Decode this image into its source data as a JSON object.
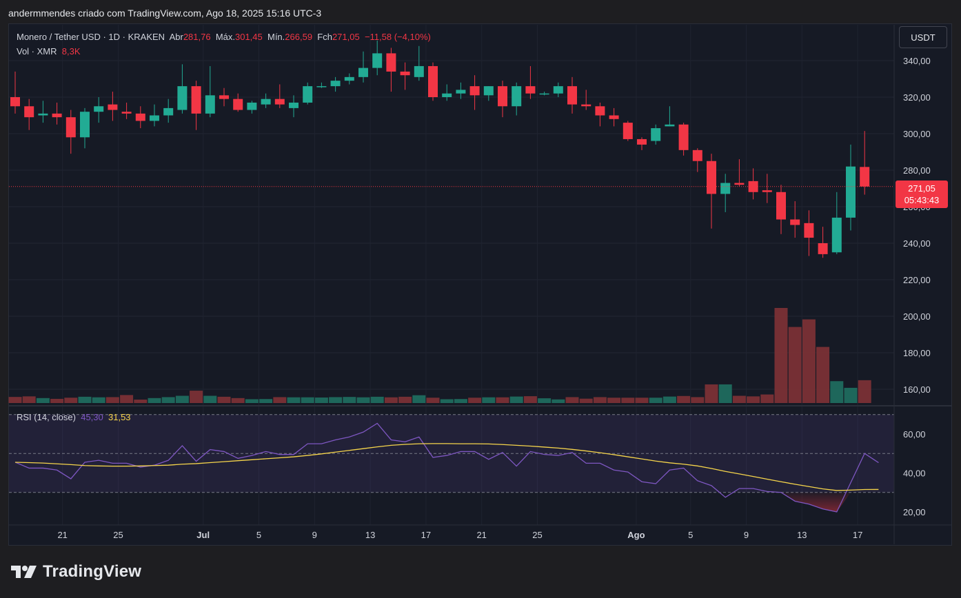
{
  "header": {
    "attribution": "andermmendes criado com TradingView.com, Ago 18, 2025 15:16 UTC-3"
  },
  "legend": {
    "symbol": "Monero / Tether USD · 1D · KRAKEN",
    "open_label": "Abr",
    "open": "281,76",
    "high_label": "Máx.",
    "high": "301,45",
    "low_label": "Mín.",
    "low": "266,59",
    "close_label": "Fch",
    "close": "271,05",
    "change": "−11,58 (−4,10%)",
    "volume_label": "Vol · XMR",
    "volume": "8,3K"
  },
  "currency_button": "USDT",
  "price_tag": {
    "price": "271,05",
    "countdown": "05:43:43"
  },
  "rsi_legend": {
    "label": "RSI (14, close)",
    "rsi": "45,30",
    "ma": "31,53"
  },
  "logo": {
    "text": "TradingView"
  },
  "colors": {
    "up": "#22ab94",
    "down": "#f23645",
    "rsi": "#7e57c2",
    "rsi_ma": "#f7d64b",
    "background": "#161a25"
  },
  "chart_data": [
    {
      "type": "candlestick",
      "title": "Monero / Tether USD · 1D · KRAKEN",
      "ylim": [
        150,
        350
      ],
      "y_ticks": [
        "160,00",
        "180,00",
        "200,00",
        "220,00",
        "240,00",
        "260,00",
        "280,00",
        "300,00",
        "320,00",
        "340,00"
      ],
      "x_ticks": [
        "21",
        "25",
        "Jul",
        "5",
        "9",
        "13",
        "17",
        "21",
        "25",
        "Ago",
        "5",
        "9",
        "13",
        "17"
      ],
      "current_price": 271.05,
      "candles": [
        {
          "o": 320,
          "h": 334,
          "l": 311,
          "c": 315
        },
        {
          "o": 315,
          "h": 319,
          "l": 302,
          "c": 309
        },
        {
          "o": 310,
          "h": 318,
          "l": 306,
          "c": 311
        },
        {
          "o": 311,
          "h": 317,
          "l": 305,
          "c": 309
        },
        {
          "o": 309,
          "h": 313,
          "l": 289,
          "c": 298
        },
        {
          "o": 298,
          "h": 314,
          "l": 292,
          "c": 312
        },
        {
          "o": 312,
          "h": 320,
          "l": 306,
          "c": 315
        },
        {
          "o": 316,
          "h": 323,
          "l": 307,
          "c": 313
        },
        {
          "o": 312,
          "h": 317,
          "l": 308,
          "c": 311
        },
        {
          "o": 311,
          "h": 315,
          "l": 303,
          "c": 307
        },
        {
          "o": 307,
          "h": 316,
          "l": 304,
          "c": 310
        },
        {
          "o": 310,
          "h": 319,
          "l": 306,
          "c": 314
        },
        {
          "o": 313,
          "h": 338,
          "l": 311,
          "c": 326
        },
        {
          "o": 326,
          "h": 329,
          "l": 302,
          "c": 311
        },
        {
          "o": 311,
          "h": 337,
          "l": 309,
          "c": 321
        },
        {
          "o": 321,
          "h": 325,
          "l": 315,
          "c": 319
        },
        {
          "o": 319,
          "h": 322,
          "l": 312,
          "c": 313
        },
        {
          "o": 313,
          "h": 318,
          "l": 311,
          "c": 317
        },
        {
          "o": 316,
          "h": 322,
          "l": 314,
          "c": 319
        },
        {
          "o": 319,
          "h": 327,
          "l": 314,
          "c": 316
        },
        {
          "o": 314,
          "h": 321,
          "l": 309,
          "c": 317
        },
        {
          "o": 317,
          "h": 328,
          "l": 316,
          "c": 326
        },
        {
          "o": 326,
          "h": 328,
          "l": 325,
          "c": 326
        },
        {
          "o": 326,
          "h": 331,
          "l": 323,
          "c": 329
        },
        {
          "o": 329,
          "h": 333,
          "l": 327,
          "c": 331
        },
        {
          "o": 331,
          "h": 345,
          "l": 328,
          "c": 336
        },
        {
          "o": 336,
          "h": 351,
          "l": 332,
          "c": 344
        },
        {
          "o": 344,
          "h": 347,
          "l": 323,
          "c": 334
        },
        {
          "o": 334,
          "h": 339,
          "l": 324,
          "c": 332
        },
        {
          "o": 331,
          "h": 348,
          "l": 329,
          "c": 337
        },
        {
          "o": 337,
          "h": 339,
          "l": 318,
          "c": 320
        },
        {
          "o": 320,
          "h": 327,
          "l": 318,
          "c": 322
        },
        {
          "o": 322,
          "h": 328,
          "l": 319,
          "c": 324
        },
        {
          "o": 326,
          "h": 332,
          "l": 313,
          "c": 321
        },
        {
          "o": 321,
          "h": 326,
          "l": 318,
          "c": 326
        },
        {
          "o": 326,
          "h": 329,
          "l": 309,
          "c": 315
        },
        {
          "o": 315,
          "h": 328,
          "l": 310,
          "c": 326
        },
        {
          "o": 326,
          "h": 337,
          "l": 319,
          "c": 322
        },
        {
          "o": 322,
          "h": 323,
          "l": 321,
          "c": 322
        },
        {
          "o": 322,
          "h": 328,
          "l": 320,
          "c": 326
        },
        {
          "o": 326,
          "h": 331,
          "l": 311,
          "c": 316
        },
        {
          "o": 316,
          "h": 324,
          "l": 313,
          "c": 315
        },
        {
          "o": 315,
          "h": 317,
          "l": 304,
          "c": 310
        },
        {
          "o": 310,
          "h": 314,
          "l": 304,
          "c": 308
        },
        {
          "o": 306,
          "h": 307,
          "l": 296,
          "c": 297
        },
        {
          "o": 297,
          "h": 298,
          "l": 291,
          "c": 294
        },
        {
          "o": 296,
          "h": 305,
          "l": 294,
          "c": 303
        },
        {
          "o": 304,
          "h": 315,
          "l": 304,
          "c": 305
        },
        {
          "o": 305,
          "h": 306,
          "l": 288,
          "c": 291
        },
        {
          "o": 291,
          "h": 292,
          "l": 279,
          "c": 285
        },
        {
          "o": 285,
          "h": 289,
          "l": 248,
          "c": 267
        },
        {
          "o": 267,
          "h": 278,
          "l": 257,
          "c": 273
        },
        {
          "o": 273,
          "h": 286,
          "l": 271,
          "c": 272
        },
        {
          "o": 274,
          "h": 281,
          "l": 264,
          "c": 268
        },
        {
          "o": 269,
          "h": 278,
          "l": 262,
          "c": 268
        },
        {
          "o": 268,
          "h": 272,
          "l": 245,
          "c": 253
        },
        {
          "o": 253,
          "h": 263,
          "l": 243,
          "c": 250
        },
        {
          "o": 251,
          "h": 258,
          "l": 233,
          "c": 243
        },
        {
          "o": 240,
          "h": 249,
          "l": 232,
          "c": 234
        },
        {
          "o": 235,
          "h": 268,
          "l": 234,
          "c": 254
        },
        {
          "o": 254,
          "h": 294,
          "l": 247,
          "c": 282
        },
        {
          "o": 281.76,
          "h": 301.45,
          "l": 266.59,
          "c": 271.05
        }
      ],
      "volume": [
        3.2,
        3.5,
        2.6,
        2.2,
        2.8,
        3.3,
        3.0,
        3.1,
        4.2,
        1.8,
        2.6,
        3.1,
        3.8,
        6.5,
        3.8,
        3.3,
        2.6,
        2.0,
        2.1,
        3.1,
        3.0,
        3.0,
        2.9,
        3.1,
        3.2,
        3.0,
        3.3,
        3.0,
        3.3,
        4.1,
        2.8,
        2.0,
        2.1,
        2.8,
        3.0,
        3.0,
        3.4,
        3.6,
        2.5,
        1.9,
        3.1,
        2.3,
        3.1,
        2.8,
        2.8,
        2.8,
        2.8,
        3.4,
        3.7,
        3.1,
        9.8,
        9.8,
        3.8,
        3.5,
        4.5,
        50.0,
        40.0,
        44.0,
        29.5,
        11.5,
        8.0,
        12.0
      ],
      "volume_scale_note": "relative bar heights"
    },
    {
      "type": "line",
      "title": "RSI (14, close)",
      "ylim": [
        15,
        75
      ],
      "y_ticks": [
        "20,00",
        "40,00",
        "60,00"
      ],
      "bands": [
        30,
        50,
        70
      ],
      "series": [
        {
          "name": "RSI",
          "values": [
            45.5,
            42.5,
            42.5,
            41.5,
            37,
            45.5,
            46.5,
            45,
            45,
            43,
            44,
            46.5,
            54,
            46,
            52,
            51,
            47.5,
            49,
            51,
            49.5,
            49.5,
            55,
            55,
            57,
            58.5,
            61,
            65.5,
            57,
            56,
            58.5,
            48,
            49,
            51,
            51,
            47,
            50.5,
            43.5,
            51,
            49.5,
            49,
            50.5,
            45,
            45,
            41.5,
            40.5,
            35.5,
            34.5,
            41.5,
            42.5,
            36,
            33.5,
            27.5,
            32,
            32,
            30.5,
            30,
            25.5,
            24,
            21.5,
            20,
            35,
            50,
            45.3
          ]
        },
        {
          "name": "RSI-based MA",
          "values": [
            45.5,
            45.3,
            45.1,
            44.7,
            44.3,
            43.8,
            43.6,
            43.5,
            43.5,
            43.6,
            43.8,
            44,
            44.5,
            44.8,
            45.3,
            45.8,
            46.3,
            46.8,
            47.3,
            47.8,
            48.3,
            49,
            49.8,
            50.7,
            51.6,
            52.5,
            53.4,
            54.2,
            54.7,
            55,
            55.1,
            55.1,
            55,
            55,
            54.9,
            54.6,
            54.2,
            53.8,
            53.3,
            52.8,
            52.1,
            51.3,
            50.4,
            49.4,
            48.3,
            47.2,
            46.1,
            45.2,
            44.5,
            43.6,
            42.3,
            40.8,
            39.5,
            38.2,
            36.8,
            35.5,
            34.2,
            33,
            31.8,
            31,
            31.2,
            31.5,
            31.53
          ]
        }
      ]
    }
  ]
}
